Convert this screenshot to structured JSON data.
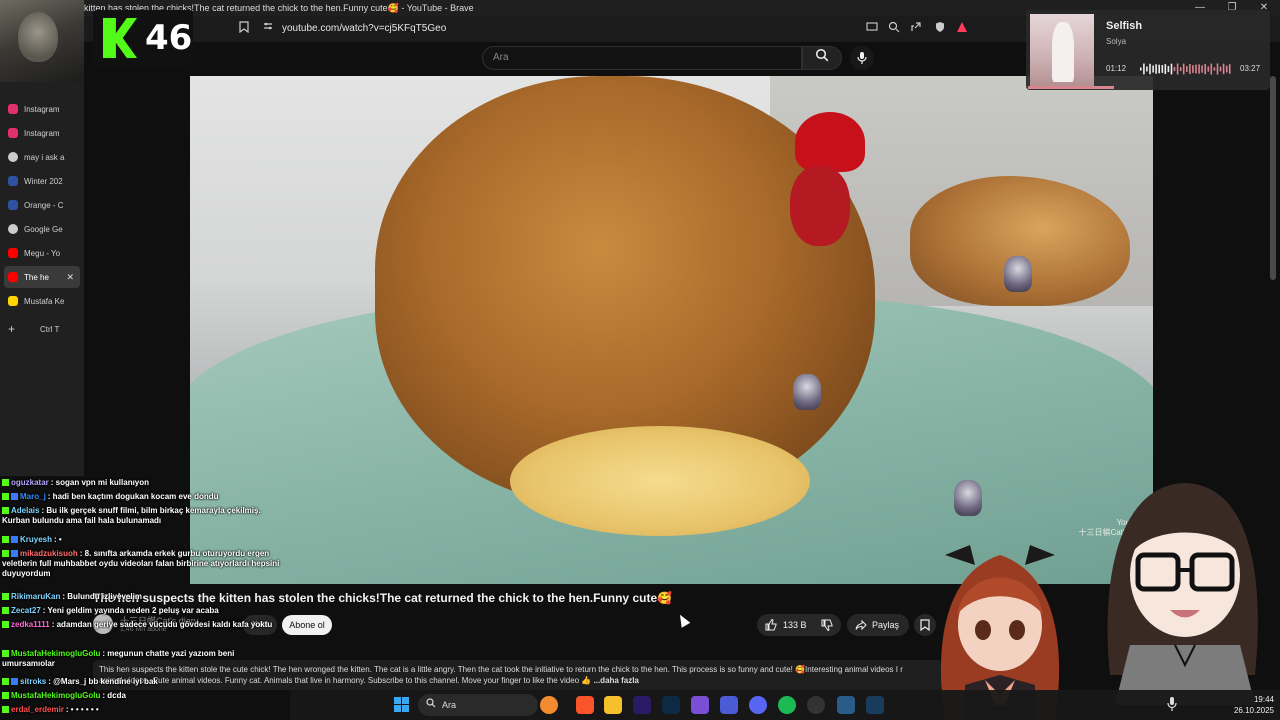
{
  "window": {
    "title": "kitten has stolen the chicks!The cat returned the chick to the hen.Funny cute🥰 - YouTube - Brave",
    "min_label": "—",
    "max_label": "❐",
    "close_label": "✕"
  },
  "browser": {
    "url": "youtube.com/watch?v=cj5KFqT5Geo"
  },
  "overlay": {
    "score": "46",
    "logo_color": "#53fc18"
  },
  "sidebar": {
    "items": [
      {
        "label": "Instagram",
        "icon": "instagram-icon",
        "color": "#e1306c"
      },
      {
        "label": "Instagram",
        "icon": "instagram-icon",
        "color": "#e1306c"
      },
      {
        "label": "may i ask a",
        "icon": "openai-icon",
        "color": "#cccccc"
      },
      {
        "label": "Winter 202",
        "icon": "mal-icon",
        "color": "#2e51a2"
      },
      {
        "label": "Orange - C",
        "icon": "mal-icon",
        "color": "#2e51a2"
      },
      {
        "label": "Google Ge",
        "icon": "gemini-icon",
        "color": "#cccccc"
      },
      {
        "label": "Megu - Yo",
        "icon": "youtube-icon",
        "color": "#ff0000"
      },
      {
        "label": "The he",
        "icon": "youtube-icon",
        "color": "#ff0000"
      },
      {
        "label": "Mustafa Ke",
        "icon": "kick-icon",
        "color": "#ffd400"
      }
    ],
    "active_close": "✕",
    "new_tab": "+",
    "shortcut": "Ctrl   T"
  },
  "youtube": {
    "search_placeholder": "Ara",
    "video_title": "The hen suspects the kitten has stolen the chicks!The cat returned the chick to the hen.Funny cute🥰",
    "channel_name": "十三日帺Cat's diary",
    "channel_subs": "1,46 Mn abone",
    "katil_label": "Katil",
    "subscribe_label": "Abone ol",
    "likes": "133 B",
    "share_label": "Paylaş",
    "description": "This hen suspects the kitten stole the cute chick! The hen wronged the kitten. The cat is a little angry. Then the cat took the initiative to return the chick to the hen. This process is so funny and cute! 🥰Interesting animal videos I r",
    "description2": "animal videos. Cute animal videos. Funny cat. Animals that live in harmony. Subscribe to this channel. Move your finger to like the video 👍",
    "more_label": "...daha fazla",
    "watermark": "YouTube\n十三日帺Cat's diary"
  },
  "chat": [
    {
      "badge": "g",
      "user": "oguzkatar",
      "color": "#b5a3ff",
      "msg": ": sogan vpn mi kullanıyon"
    },
    {
      "badge": "gb",
      "user": "Maro_j",
      "color": "#2f8cff",
      "msg": ": hadi ben kaçtım dogukan kocam eve dondu"
    },
    {
      "badge": "g",
      "user": "Adelais",
      "color": "#7fd4ff",
      "msg": ": Bu ilk gerçek snuff filmi, bilm birkaç kemarayla çekilmiş. Kurban bulundu ama fail hala bulunamadı"
    },
    {
      "badge": "gb",
      "user": "Kruyesh",
      "color": "#7fd4ff",
      "msg": ": •"
    },
    {
      "badge": "gb",
      "user": "mikadzukisuoh",
      "color": "#ff6b6b",
      "msg": ": 8. sınıfta arkamda erkek gurbu oturuyordu ergen veletlerin full muhbabbet oydu videoları falan birbirine atıyorlardı hepsini duyuyordum"
    },
    {
      "badge": "g",
      "user": "RikimaruKan",
      "color": "#7fd4ff",
      "msg": ": Bulundu izliyevelim"
    },
    {
      "badge": "g",
      "user": "Zecat27",
      "color": "#7fd4ff",
      "msg": ": Yeni geldim yayında neden 2 peluş var acaba"
    },
    {
      "badge": "g",
      "user": "zedka1111",
      "color": "#ff6bd5",
      "msg": ": adamdan geriye sadece vücudu gövdesi kaldı kafa yoktu"
    },
    {
      "badge": "g",
      "user": "MustafaHekimogluGolu",
      "color": "#53fc18",
      "msg": ": megunun chatte yazi yazıom beni umursamıolar"
    },
    {
      "badge": "gb",
      "user": "sitroks",
      "color": "#7fd4ff",
      "msg": ": @Mars_j bb kendine iyi bak"
    },
    {
      "badge": "g",
      "user": "MustafaHekimogluGolu",
      "color": "#53fc18",
      "msg": ": dcda"
    },
    {
      "badge": "g",
      "user": "erdal_erdemir",
      "color": "#ff4f4f",
      "msg": ": • • • • • •"
    }
  ],
  "music": {
    "title": "Selfish",
    "artist": "Solya",
    "current": "01:12",
    "total": "03:27",
    "progress": 0.35
  },
  "taskbar": {
    "search": "Ara",
    "time": "19:44",
    "date": "26.10.2025"
  }
}
